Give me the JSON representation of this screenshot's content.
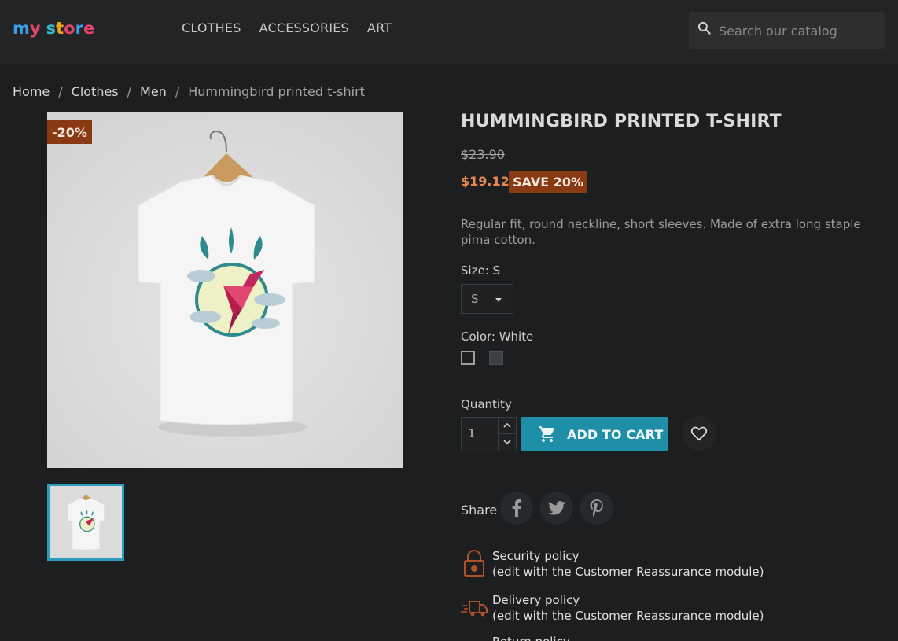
{
  "header": {
    "logo_text": "my store",
    "nav": [
      "CLOTHES",
      "ACCESSORIES",
      "ART"
    ],
    "search_placeholder": "Search our catalog"
  },
  "breadcrumb": [
    "Home",
    "Clothes",
    "Men",
    "Hummingbird printed t-shirt"
  ],
  "product": {
    "discount_flag": "-20%",
    "title": "HUMMINGBIRD PRINTED T-SHIRT",
    "old_price": "$23.90",
    "new_price": "$19.12",
    "save_badge": "SAVE 20%",
    "description": "Regular fit, round neckline, short sleeves. Made of extra long staple pima cotton.",
    "size_label": "Size: S",
    "size_selected": "S",
    "color_label": "Color: White",
    "colors": [
      "White",
      "Black"
    ],
    "quantity_label": "Quantity",
    "quantity_value": "1",
    "add_to_cart": "ADD TO CART",
    "share_label": "Share"
  },
  "reassurance": [
    {
      "title": "Security policy",
      "subtitle": "(edit with the Customer Reassurance module)",
      "icon": "lock-icon"
    },
    {
      "title": "Delivery policy",
      "subtitle": "(edit with the Customer Reassurance module)",
      "icon": "truck-icon"
    },
    {
      "title": "Return policy",
      "subtitle": "",
      "icon": "return-icon"
    }
  ],
  "colors": {
    "accent": "#1f8fa7",
    "discount": "#8a3a12",
    "price": "#e88a50"
  }
}
